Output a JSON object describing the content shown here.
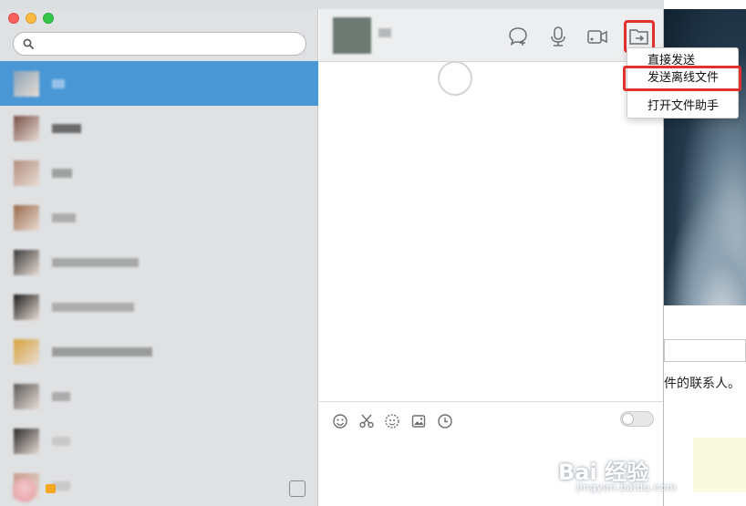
{
  "search": {
    "placeholder": "",
    "value": ""
  },
  "contacts": [
    {
      "selected": true,
      "avatar_color": "#8aa3b8",
      "name_color": "#a9cdf0",
      "name_width": 14
    },
    {
      "selected": false,
      "avatar_color": "#7a4f48",
      "name_color": "#505050",
      "name_width": 32
    },
    {
      "selected": false,
      "avatar_color": "#b38e7e",
      "name_color": "#909090",
      "name_width": 22
    },
    {
      "selected": false,
      "avatar_color": "#9a6a4a",
      "name_color": "#a0a0a0",
      "name_width": 26
    },
    {
      "selected": false,
      "avatar_color": "#3a3a3a",
      "name_color": "#9a9a9a",
      "name_width": 95
    },
    {
      "selected": false,
      "avatar_color": "#1e1e1e",
      "name_color": "#a0a0a0",
      "name_width": 90
    },
    {
      "selected": false,
      "avatar_color": "#d7a43d",
      "name_color": "#8a8a8a",
      "name_width": 110
    },
    {
      "selected": false,
      "avatar_color": "#5b5b5b",
      "name_color": "#a0a0a0",
      "name_width": 20
    },
    {
      "selected": false,
      "avatar_color": "#2a2a2a",
      "name_color": "#c4c4c4",
      "name_width": 20
    },
    {
      "selected": false,
      "avatar_color": "#c79b8a",
      "name_color": "#c4c4c4",
      "name_width": 20
    }
  ],
  "chat_header": {
    "buttons": [
      "chat-bubble",
      "microphone",
      "video-camera",
      "send-file"
    ]
  },
  "send_menu": {
    "items": [
      {
        "label": "直接发送"
      },
      {
        "label": "发送离线文件"
      },
      {
        "label": "打开文件助手"
      }
    ]
  },
  "toolbar": {
    "tools": [
      "emoji",
      "scissors",
      "sticker",
      "image",
      "clock"
    ]
  },
  "background": {
    "text": "件的联系人。"
  },
  "watermark": {
    "brand": "Bai 经验",
    "url": "jingyan.baidu.com"
  },
  "colors": {
    "selection": "#4a97d6",
    "highlight": "#e0312f"
  }
}
